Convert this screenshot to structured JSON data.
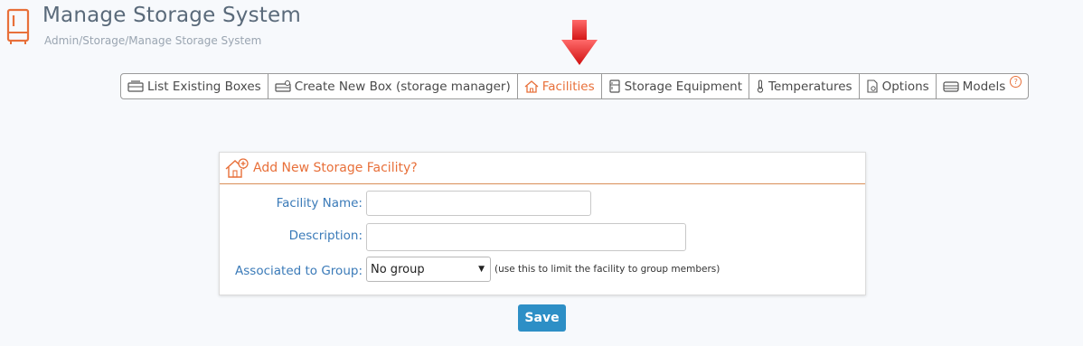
{
  "header": {
    "title": "Manage Storage System",
    "breadcrumb": "Admin/Storage/Manage Storage System"
  },
  "tabs": [
    {
      "label": "List Existing Boxes",
      "icon": "boxes-icon"
    },
    {
      "label": "Create New Box (storage manager)",
      "icon": "create-box-icon"
    },
    {
      "label": "Facilities",
      "icon": "home-icon",
      "active": true
    },
    {
      "label": "Storage Equipment",
      "icon": "freezer-icon"
    },
    {
      "label": "Temperatures",
      "icon": "thermometer-icon"
    },
    {
      "label": "Options",
      "icon": "options-icon"
    },
    {
      "label": "Models",
      "icon": "model-icon",
      "help": "?"
    }
  ],
  "form": {
    "title": "Add New Storage Facility?",
    "facility_name_label": "Facility Name:",
    "facility_name_value": "",
    "description_label": "Description:",
    "description_value": "",
    "group_label": "Associated to Group:",
    "group_selected": "No group",
    "group_hint": "(use this to limit the facility to group members)"
  },
  "save_label": "Save",
  "colors": {
    "accent": "#e8703a",
    "label": "#3a7ab8",
    "button": "#2d8fc6",
    "arrow": "#e02020"
  }
}
